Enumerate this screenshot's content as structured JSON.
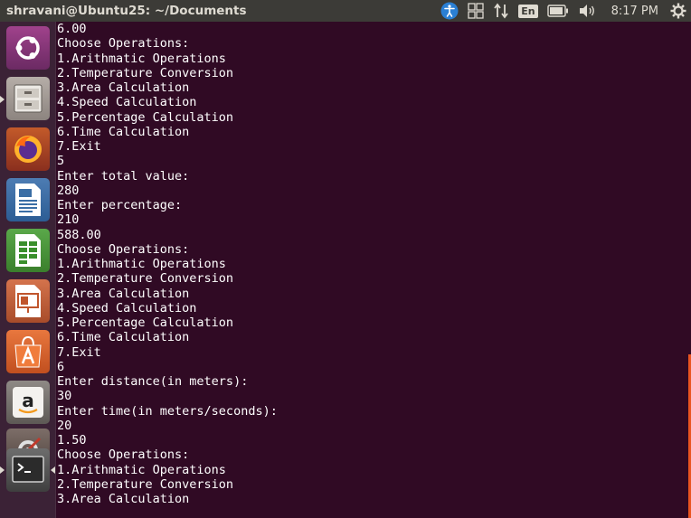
{
  "window": {
    "title": "shravani@Ubuntu25: ~/Documents"
  },
  "panel": {
    "keyboard_layout": "En",
    "clock": "8:17 PM"
  },
  "launcher": {
    "items": [
      {
        "name": "ubuntu-dash"
      },
      {
        "name": "files"
      },
      {
        "name": "firefox"
      },
      {
        "name": "libreoffice-writer"
      },
      {
        "name": "libreoffice-calc"
      },
      {
        "name": "libreoffice-impress"
      },
      {
        "name": "ubuntu-software"
      },
      {
        "name": "amazon"
      },
      {
        "name": "system-settings"
      },
      {
        "name": "terminal"
      }
    ]
  },
  "terminal": {
    "lines": [
      "6.00",
      "Choose Operations:",
      "1.Arithmatic Operations",
      "2.Temperature Conversion",
      "3.Area Calculation",
      "4.Speed Calculation",
      "5.Percentage Calculation",
      "6.Time Calculation",
      "7.Exit",
      "5",
      "Enter total value:",
      "280",
      "Enter percentage:",
      "210",
      "588.00",
      "Choose Operations:",
      "1.Arithmatic Operations",
      "2.Temperature Conversion",
      "3.Area Calculation",
      "4.Speed Calculation",
      "5.Percentage Calculation",
      "6.Time Calculation",
      "7.Exit",
      "6",
      "Enter distance(in meters):",
      "30",
      "Enter time(in meters/seconds):",
      "20",
      "1.50",
      "Choose Operations:",
      "1.Arithmatic Operations",
      "2.Temperature Conversion",
      "3.Area Calculation"
    ]
  },
  "colors": {
    "terminal_bg": "#300a24",
    "accent": "#e95420",
    "panel_bg": "#3c3b37"
  }
}
